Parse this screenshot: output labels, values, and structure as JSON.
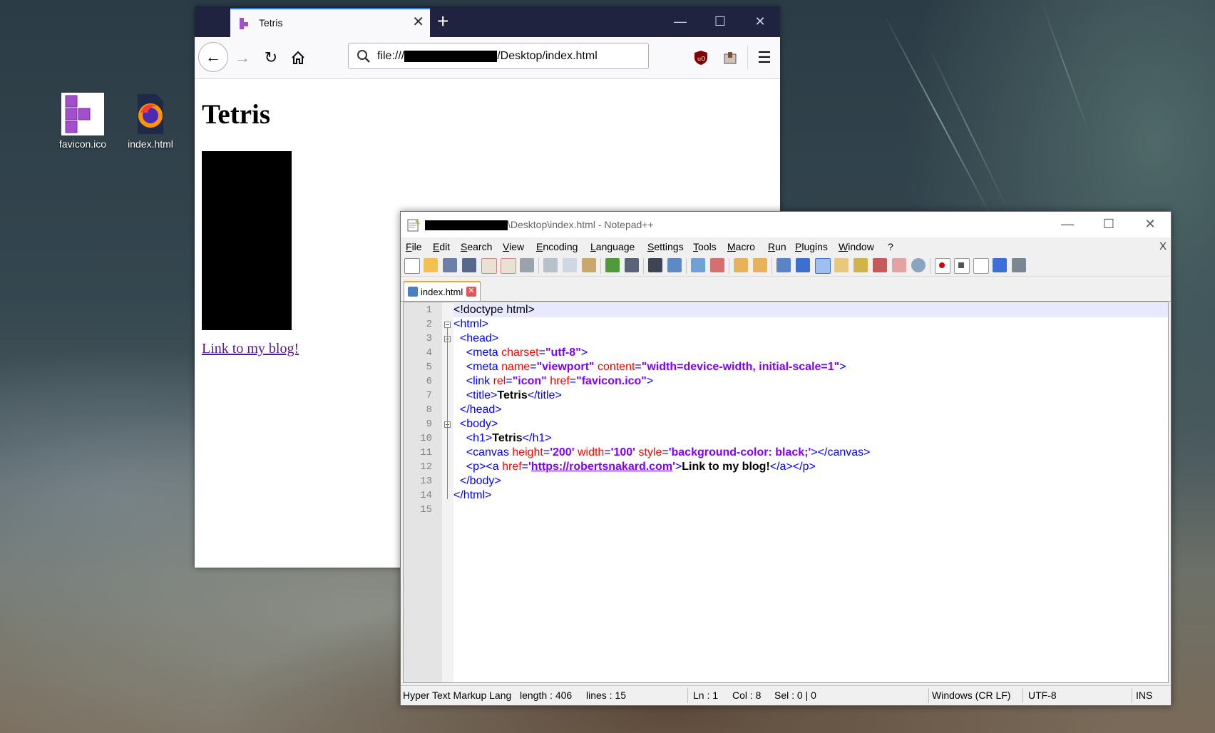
{
  "desktop": {
    "icons": [
      {
        "label": "favicon.ico",
        "icon": "tetris-t-icon"
      },
      {
        "label": "index.html",
        "icon": "firefox-html-icon"
      }
    ]
  },
  "browser": {
    "tab_title": "Tetris",
    "url_prefix": "file:///",
    "url_suffix": "/Desktop/index.html",
    "page": {
      "heading": "Tetris",
      "link_text": "Link to my blog!"
    },
    "colors": {
      "titlebar": "#202340",
      "tab_accent": "#0a84ff",
      "link": "#551a8b"
    }
  },
  "notepad": {
    "title_suffix": "\\Desktop\\index.html - Notepad++",
    "menu": [
      "File",
      "Edit",
      "Search",
      "View",
      "Encoding",
      "Language",
      "Settings",
      "Tools",
      "Macro",
      "Run",
      "Plugins",
      "Window",
      "?"
    ],
    "close_doc_label": "X",
    "tab_label": "index.html",
    "code_lines": [
      {
        "n": "1",
        "fold": "",
        "parts": [
          [
            "doc",
            "<!doctype html>"
          ]
        ]
      },
      {
        "n": "2",
        "fold": "open",
        "parts": [
          [
            "tag",
            "<html>"
          ]
        ]
      },
      {
        "n": "3",
        "fold": "open",
        "parts": [
          [
            "txt",
            "  "
          ],
          [
            "tag",
            "<head>"
          ]
        ]
      },
      {
        "n": "4",
        "fold": "",
        "parts": [
          [
            "txt",
            "    "
          ],
          [
            "tag",
            "<meta "
          ],
          [
            "attr",
            "charset"
          ],
          [
            "tag",
            "="
          ],
          [
            "val",
            "\"utf-8\""
          ],
          [
            "tag",
            ">"
          ]
        ]
      },
      {
        "n": "5",
        "fold": "",
        "parts": [
          [
            "txt",
            "    "
          ],
          [
            "tag",
            "<meta "
          ],
          [
            "attr",
            "name"
          ],
          [
            "tag",
            "="
          ],
          [
            "val",
            "\"viewport\""
          ],
          [
            "tag",
            " "
          ],
          [
            "attr",
            "content"
          ],
          [
            "tag",
            "="
          ],
          [
            "val",
            "\"width=device-width, initial-scale=1\""
          ],
          [
            "tag",
            ">"
          ]
        ]
      },
      {
        "n": "6",
        "fold": "",
        "parts": [
          [
            "txt",
            "    "
          ],
          [
            "tag",
            "<link "
          ],
          [
            "attr",
            "rel"
          ],
          [
            "tag",
            "="
          ],
          [
            "val",
            "\"icon\""
          ],
          [
            "tag",
            " "
          ],
          [
            "attr",
            "href"
          ],
          [
            "tag",
            "="
          ],
          [
            "val",
            "\"favicon.ico\""
          ],
          [
            "tag",
            ">"
          ]
        ]
      },
      {
        "n": "7",
        "fold": "",
        "parts": [
          [
            "txt",
            "    "
          ],
          [
            "tag",
            "<title>"
          ],
          [
            "txt",
            "Tetris"
          ],
          [
            "tag",
            "</title>"
          ]
        ]
      },
      {
        "n": "8",
        "fold": "end",
        "parts": [
          [
            "txt",
            "  "
          ],
          [
            "tag",
            "</head>"
          ]
        ]
      },
      {
        "n": "9",
        "fold": "open",
        "parts": [
          [
            "txt",
            "  "
          ],
          [
            "tag",
            "<body>"
          ]
        ]
      },
      {
        "n": "10",
        "fold": "",
        "parts": [
          [
            "txt",
            "    "
          ],
          [
            "tag",
            "<h1>"
          ],
          [
            "txt",
            "Tetris"
          ],
          [
            "tag",
            "</h1>"
          ]
        ]
      },
      {
        "n": "11",
        "fold": "",
        "parts": [
          [
            "txt",
            "    "
          ],
          [
            "tag",
            "<canvas "
          ],
          [
            "attr",
            "height"
          ],
          [
            "tag",
            "="
          ],
          [
            "val",
            "'200'"
          ],
          [
            "tag",
            " "
          ],
          [
            "attr",
            "width"
          ],
          [
            "tag",
            "="
          ],
          [
            "val",
            "'100'"
          ],
          [
            "tag",
            " "
          ],
          [
            "attr",
            "style"
          ],
          [
            "tag",
            "="
          ],
          [
            "val",
            "'background-color: black;'"
          ],
          [
            "tag",
            "></canvas>"
          ]
        ]
      },
      {
        "n": "12",
        "fold": "",
        "parts": [
          [
            "txt",
            "    "
          ],
          [
            "tag",
            "<p><a "
          ],
          [
            "attr",
            "href"
          ],
          [
            "tag",
            "="
          ],
          [
            "val",
            "'"
          ],
          [
            "link",
            "https://robertsnakard.com"
          ],
          [
            "val",
            "'"
          ],
          [
            "tag",
            ">"
          ],
          [
            "txt",
            "Link to my blog!"
          ],
          [
            "tag",
            "</a></p>"
          ]
        ]
      },
      {
        "n": "13",
        "fold": "end",
        "parts": [
          [
            "txt",
            "  "
          ],
          [
            "tag",
            "</body>"
          ]
        ]
      },
      {
        "n": "14",
        "fold": "end",
        "parts": [
          [
            "tag",
            "</html>"
          ]
        ]
      },
      {
        "n": "15",
        "fold": "",
        "parts": []
      }
    ],
    "status": {
      "language": "Hyper Text Markup Lang",
      "length": "length : 406",
      "lines": "lines : 15",
      "ln": "Ln : 1",
      "col": "Col : 8",
      "sel": "Sel : 0 | 0",
      "eol": "Windows (CR LF)",
      "encoding": "UTF-8",
      "mode": "INS"
    }
  }
}
